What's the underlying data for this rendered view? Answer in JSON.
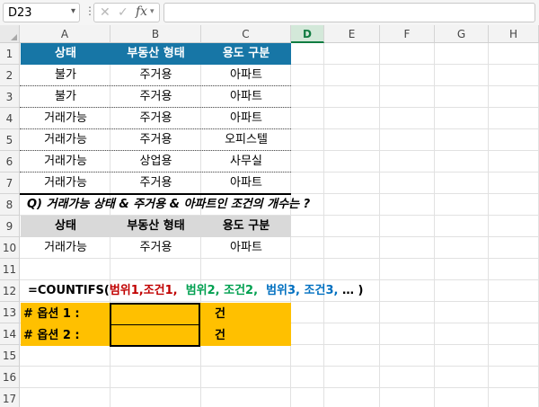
{
  "formula_bar": {
    "name_box": "D23",
    "name_box_arrow": "▾",
    "more_dots": "⋮",
    "cancel_glyph": "✕",
    "enter_glyph": "✓",
    "fx_label": "fx",
    "fx_arrow": "▾",
    "formula_value": ""
  },
  "columns": [
    "A",
    "B",
    "C",
    "D",
    "E",
    "F",
    "G",
    "H"
  ],
  "active_column": "D",
  "rows": [
    "1",
    "2",
    "3",
    "4",
    "5",
    "6",
    "7",
    "8",
    "9",
    "10",
    "11",
    "12",
    "13",
    "14",
    "15",
    "16",
    "17"
  ],
  "table1": {
    "headers": [
      "상태",
      "부동산 형태",
      "용도 구분"
    ],
    "rows": [
      [
        "불가",
        "주거용",
        "아파트"
      ],
      [
        "불가",
        "주거용",
        "아파트"
      ],
      [
        "거래가능",
        "주거용",
        "아파트"
      ],
      [
        "거래가능",
        "주거용",
        "오피스텔"
      ],
      [
        "거래가능",
        "상업용",
        "사무실"
      ],
      [
        "거래가능",
        "주거용",
        "아파트"
      ]
    ]
  },
  "question": "Q) 거래가능 상태 & 주거용 & 아파트인 조건의 개수는 ?",
  "table2": {
    "headers": [
      "상태",
      "부동산 형태",
      "용도 구분"
    ],
    "row": [
      "거래가능",
      "주거용",
      "아파트"
    ]
  },
  "formula_hint": {
    "prefix": "=COUNTIFS(",
    "red": "범위1,조건1,",
    "green": "범위2, 조건2,",
    "blue": "범위3, 조건3,",
    "suffix": "… )"
  },
  "options": [
    {
      "label": "# 옵션 1 :",
      "unit": "건"
    },
    {
      "label": "# 옵션 2 :",
      "unit": "건"
    }
  ],
  "colors": {
    "header_blue": "#1776a6",
    "header_gray": "#d9d9d9",
    "highlight_gold": "#ffc000",
    "excel_green": "#107c41"
  }
}
